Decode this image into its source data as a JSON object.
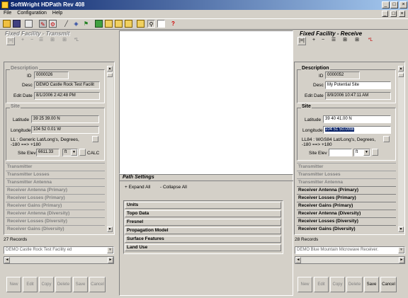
{
  "window": {
    "title": "SoftWright HDPath Rev 408",
    "controls": [
      "_",
      "□",
      "×"
    ],
    "inner_controls": [
      "_",
      "□",
      "×"
    ]
  },
  "menu": [
    "File",
    "Configuration",
    "Help"
  ],
  "toolbar_icons": [
    "open-icon",
    "save-icon",
    "print-icon",
    "settings-icon",
    "tool-icon",
    "ruler-icon",
    "compass-icon",
    "flag-icon",
    "map-icon",
    "folder-icon",
    "folder-icon",
    "folder-icon",
    "zoom-icon",
    "document-icon",
    "help-icon"
  ],
  "left": {
    "title": "Fixed Facility - Transmit",
    "toolbar": [
      "|=|",
      "+",
      "−",
      "☰",
      "⊞",
      "⊞",
      "*L"
    ],
    "description": {
      "title": "Description",
      "id_label": "ID",
      "id": "0000026",
      "desc_label": "Desc",
      "desc": "DEMO Castle Rock Test Facilit",
      "date_label": "Edit Date",
      "date": "8/1/2006 2:42:48 PM"
    },
    "site": {
      "title": "Site",
      "lat_label": "Latitude",
      "lat": "39 25 39.00 N",
      "lon_label": "Longitude",
      "lon": "104 52 0.01 W",
      "ll_text1": "LL : Generic Lat/Long's, Degrees,",
      "ll_text2": "-180 ==> +180",
      "elev_label": "Site Elev",
      "elev": "6611.33",
      "unit": "ft",
      "calc": "CALC"
    },
    "sections": [
      "Transmitter",
      "Transmitter Losses",
      "Transmitter Antenna",
      "Receiver Antenna (Primary)",
      "Receiver Losses (Primary)",
      "Receiver Gains (Primary)",
      "Receiver Antenna (Diversity)",
      "Receiver Losses (Diversity)",
      "Receiver Gains (Diversity)"
    ],
    "records": "27 Records",
    "combo": "DEMO Castle Rock Test Facility ed",
    "buttons": [
      "New",
      "Edit",
      "Copy",
      "Delete",
      "Save",
      "Cancel"
    ]
  },
  "right": {
    "title": "Fixed Facility - Receive",
    "toolbar": [
      "|=|",
      "+",
      "−",
      "☰",
      "⊞",
      "⊞",
      "*L"
    ],
    "description": {
      "title": "Description",
      "id_label": "ID",
      "id": "0000052",
      "desc_label": "Desc",
      "desc": "My Potential Site",
      "date_label": "Edit Date",
      "date": "8/9/2006 10:47:11 AM"
    },
    "site": {
      "title": "Site",
      "lat_label": "Latitude",
      "lat": "39 40 41.00 N",
      "lon_label": "Longitude",
      "lon": "104 51 50.00W",
      "ll_text1": "LL84 : WGS84 Lat/Long's, Degrees,",
      "ll_text2": "-180 ==> +180",
      "elev_label": "Site Elev",
      "elev": "",
      "unit": "ft"
    },
    "sections": [
      "Transmitter",
      "Transmitter Losses",
      "Transmitter Antenna",
      "Receiver Antenna (Primary)",
      "Receiver Losses (Primary)",
      "Receiver Gains (Primary)",
      "Receiver Antenna (Diversity)",
      "Receiver Losses (Diversity)",
      "Receiver Gains (Diversity)"
    ],
    "records": "28 Records",
    "combo": "DEMO Blue Mountain Microwave Receiver.",
    "buttons": [
      "New",
      "Edit",
      "Copy",
      "Delete",
      "Save",
      "Cancel"
    ]
  },
  "path_settings": {
    "title": "Path Settings",
    "expand": "+ Expand All",
    "collapse": "- Collapse All",
    "items": [
      "Units",
      "Topo Data",
      "Fresnel",
      "Propagation Model",
      "Surface Features",
      "Land Use"
    ]
  }
}
